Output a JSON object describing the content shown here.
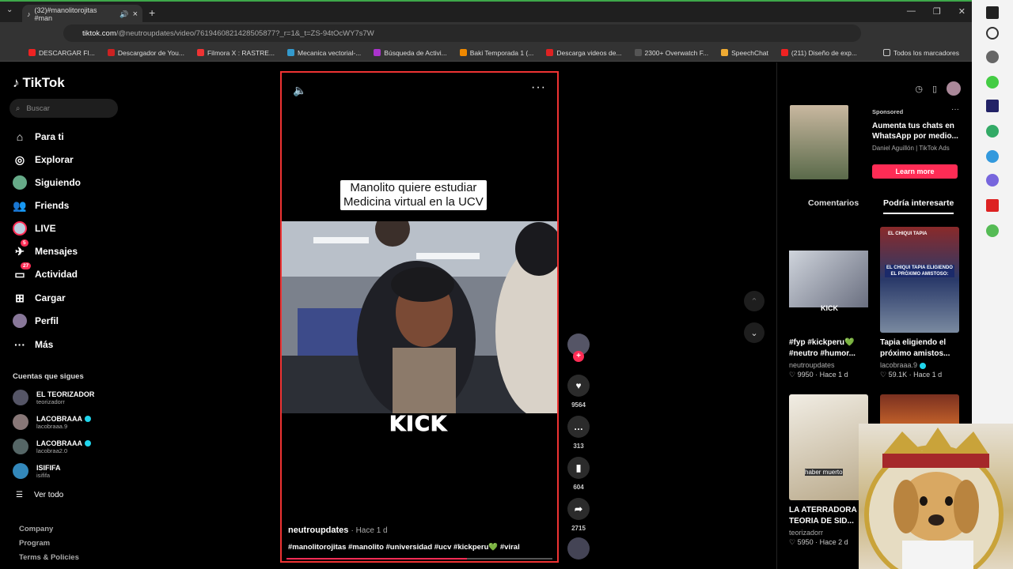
{
  "browser": {
    "tab_title": "(32)#manolitorojitas #man",
    "url_host": "tiktok.com",
    "url_path": "/@neutroupdates/video/7619460821428505877?_r=1&_t=ZS-94tOcWY7s7W",
    "bookmarks": [
      "DESCARGAR FI...",
      "Descargador de You...",
      "Filmora X : RASTRE...",
      "Mecanica vectorial-...",
      "Búsqueda de Activi...",
      "Baki Temporada 1 (...",
      "Descarga videos de...",
      "2300+ Overwatch F...",
      "SpeechChat",
      "(211) Diseño de exp..."
    ],
    "bookmarks_folder": "Todos los marcadores",
    "tab_close": "×",
    "new_tab": "+"
  },
  "tiktok": {
    "logo": "TikTok",
    "search_placeholder": "Buscar",
    "nav": [
      {
        "label": "Para ti",
        "icon": "home-icon"
      },
      {
        "label": "Explorar",
        "icon": "compass-icon"
      },
      {
        "label": "Siguiendo",
        "icon": "following-icon"
      },
      {
        "label": "Friends",
        "icon": "friends-icon"
      },
      {
        "label": "LIVE",
        "icon": "live-icon"
      },
      {
        "label": "Mensajes",
        "icon": "messages-icon",
        "badge": "5"
      },
      {
        "label": "Actividad",
        "icon": "activity-icon",
        "badge": "27"
      },
      {
        "label": "Cargar",
        "icon": "upload-icon"
      },
      {
        "label": "Perfil",
        "icon": "profile-icon"
      },
      {
        "label": "Más",
        "icon": "more-icon"
      }
    ],
    "following_title": "Cuentas que sigues",
    "following": [
      {
        "name": "EL TEORIZADOR",
        "handle": "teorizadorr",
        "verified": false
      },
      {
        "name": "LACOBRAAA",
        "handle": "lacobraaa.9",
        "verified": true
      },
      {
        "name": "LACOBRAAA",
        "handle": "lacobraa2.0",
        "verified": true
      },
      {
        "name": "ISIFIFA",
        "handle": "isififa",
        "verified": false
      }
    ],
    "see_all": "Ver todo",
    "footer": [
      "Company",
      "Program",
      "Terms & Policies"
    ]
  },
  "video": {
    "caption_line1": "Manolito quiere estudiar",
    "caption_line2": "Medicina virtual en la UCV",
    "watermark": "KICK",
    "author": "neutroupdates",
    "posted": "· Hace 1 d",
    "hashtags": "#manolitorojitas #manolito #universidad #ucv #kickperu💚 #viral",
    "progress": 0.68,
    "likes": "9564",
    "comments": "313",
    "saves": "604",
    "shares": "2715"
  },
  "right_panel": {
    "ad": {
      "sponsored": "Sponsored",
      "title": "Aumenta tus chats en WhatsApp por medio...",
      "advertiser": "Daniel Aguillón | TikTok Ads",
      "cta": "Learn more"
    },
    "tabs": [
      "Comentarios",
      "Podría interesarte"
    ],
    "cards": [
      {
        "title": "#fyp #kickperu💚 #neutro #humor...",
        "user": "neutroupdates",
        "likes": "9950",
        "age": "· Hace 1 d"
      },
      {
        "title": "Tapia eligiendo el próximo amistos...",
        "user": "lacobraaa.9",
        "likes": "59.1K",
        "age": "· Hace 1 d",
        "verified": true
      },
      {
        "title": "LA ATERRADORA TEORIA DE SID...",
        "user": "teorizadorr",
        "likes": "5950",
        "age": "· Hace 2 d"
      }
    ],
    "thumb_texts": {
      "c1": "KICK",
      "c2_a": "EL CHIQUI TAPIA",
      "c2_b": "EL CHIQUI TAPIA ELIGIENDO EL PRÓXIMO AMISTOSO:",
      "c3": "haber muerto"
    }
  },
  "colors": {
    "accent": "#fe2c55",
    "verified": "#20d5ec",
    "video_border": "#e33333"
  }
}
